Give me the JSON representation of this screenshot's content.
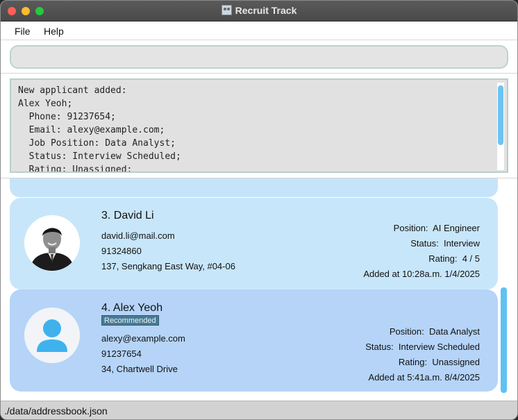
{
  "window": {
    "title": "Recruit Track"
  },
  "menu": {
    "file": "File",
    "help": "Help"
  },
  "command": {
    "value": ""
  },
  "result": {
    "lines": [
      "New applicant added:",
      "Alex Yeoh;",
      "  Phone: 91237654;",
      "  Email: alexy@example.com;",
      "  Job Position: Data Analyst;",
      "  Status: Interview Scheduled;",
      "  Rating: Unassigned;"
    ]
  },
  "applicants": [
    {
      "index_name": "3. David Li",
      "email": "david.li@mail.com",
      "phone": "91324860",
      "address": "137, Sengkang East Way, #04-06",
      "position_label": "Position:",
      "position": "AI Engineer",
      "status_label": "Status:",
      "status": "Interview",
      "rating_label": "Rating:",
      "rating": "4 / 5",
      "added": "Added at 10:28a.m. 1/4/2025"
    },
    {
      "index_name": "4. Alex Yeoh",
      "tag": "Recommended",
      "email": "alexy@example.com",
      "phone": "91237654",
      "address": "34, Chartwell Drive",
      "position_label": "Position:",
      "position": "Data Analyst",
      "status_label": "Status:",
      "status": "Interview Scheduled",
      "rating_label": "Rating:",
      "rating": "Unassigned",
      "added": "Added at 5:41a.m. 8/4/2025"
    }
  ],
  "status_bar": {
    "path": "./data/addressbook.json"
  },
  "colors": {
    "card_selected": "#b5d4f8",
    "card_default": "#c8e6fa",
    "scrollbar": "#5ec2f0",
    "badge": "#4a7a94"
  },
  "icons": [
    "close-window-icon",
    "minimize-window-icon",
    "maximize-window-icon",
    "app-icon",
    "default-avatar-icon"
  ]
}
